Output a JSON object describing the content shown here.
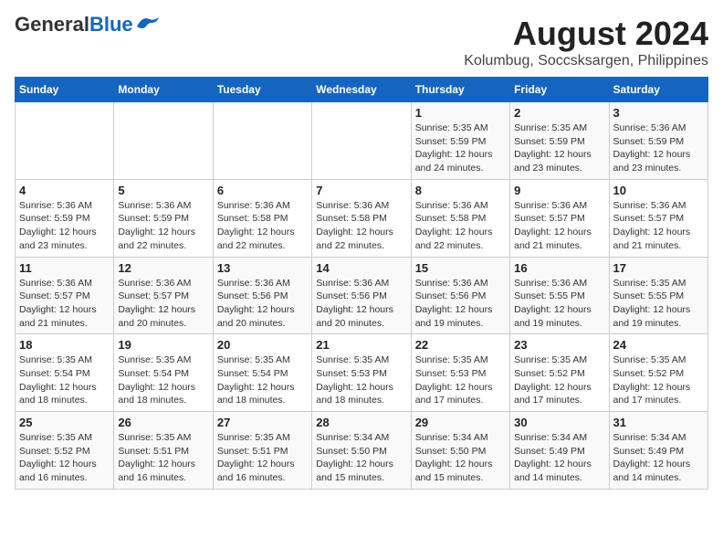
{
  "logo": {
    "general": "General",
    "blue": "Blue"
  },
  "title": "August 2024",
  "subtitle": "Kolumbug, Soccsksargen, Philippines",
  "days_of_week": [
    "Sunday",
    "Monday",
    "Tuesday",
    "Wednesday",
    "Thursday",
    "Friday",
    "Saturday"
  ],
  "weeks": [
    [
      {
        "day": "",
        "info": ""
      },
      {
        "day": "",
        "info": ""
      },
      {
        "day": "",
        "info": ""
      },
      {
        "day": "",
        "info": ""
      },
      {
        "day": "1",
        "info": "Sunrise: 5:35 AM\nSunset: 5:59 PM\nDaylight: 12 hours\nand 24 minutes."
      },
      {
        "day": "2",
        "info": "Sunrise: 5:35 AM\nSunset: 5:59 PM\nDaylight: 12 hours\nand 23 minutes."
      },
      {
        "day": "3",
        "info": "Sunrise: 5:36 AM\nSunset: 5:59 PM\nDaylight: 12 hours\nand 23 minutes."
      }
    ],
    [
      {
        "day": "4",
        "info": "Sunrise: 5:36 AM\nSunset: 5:59 PM\nDaylight: 12 hours\nand 23 minutes."
      },
      {
        "day": "5",
        "info": "Sunrise: 5:36 AM\nSunset: 5:59 PM\nDaylight: 12 hours\nand 22 minutes."
      },
      {
        "day": "6",
        "info": "Sunrise: 5:36 AM\nSunset: 5:58 PM\nDaylight: 12 hours\nand 22 minutes."
      },
      {
        "day": "7",
        "info": "Sunrise: 5:36 AM\nSunset: 5:58 PM\nDaylight: 12 hours\nand 22 minutes."
      },
      {
        "day": "8",
        "info": "Sunrise: 5:36 AM\nSunset: 5:58 PM\nDaylight: 12 hours\nand 22 minutes."
      },
      {
        "day": "9",
        "info": "Sunrise: 5:36 AM\nSunset: 5:57 PM\nDaylight: 12 hours\nand 21 minutes."
      },
      {
        "day": "10",
        "info": "Sunrise: 5:36 AM\nSunset: 5:57 PM\nDaylight: 12 hours\nand 21 minutes."
      }
    ],
    [
      {
        "day": "11",
        "info": "Sunrise: 5:36 AM\nSunset: 5:57 PM\nDaylight: 12 hours\nand 21 minutes."
      },
      {
        "day": "12",
        "info": "Sunrise: 5:36 AM\nSunset: 5:57 PM\nDaylight: 12 hours\nand 20 minutes."
      },
      {
        "day": "13",
        "info": "Sunrise: 5:36 AM\nSunset: 5:56 PM\nDaylight: 12 hours\nand 20 minutes."
      },
      {
        "day": "14",
        "info": "Sunrise: 5:36 AM\nSunset: 5:56 PM\nDaylight: 12 hours\nand 20 minutes."
      },
      {
        "day": "15",
        "info": "Sunrise: 5:36 AM\nSunset: 5:56 PM\nDaylight: 12 hours\nand 19 minutes."
      },
      {
        "day": "16",
        "info": "Sunrise: 5:36 AM\nSunset: 5:55 PM\nDaylight: 12 hours\nand 19 minutes."
      },
      {
        "day": "17",
        "info": "Sunrise: 5:35 AM\nSunset: 5:55 PM\nDaylight: 12 hours\nand 19 minutes."
      }
    ],
    [
      {
        "day": "18",
        "info": "Sunrise: 5:35 AM\nSunset: 5:54 PM\nDaylight: 12 hours\nand 18 minutes."
      },
      {
        "day": "19",
        "info": "Sunrise: 5:35 AM\nSunset: 5:54 PM\nDaylight: 12 hours\nand 18 minutes."
      },
      {
        "day": "20",
        "info": "Sunrise: 5:35 AM\nSunset: 5:54 PM\nDaylight: 12 hours\nand 18 minutes."
      },
      {
        "day": "21",
        "info": "Sunrise: 5:35 AM\nSunset: 5:53 PM\nDaylight: 12 hours\nand 18 minutes."
      },
      {
        "day": "22",
        "info": "Sunrise: 5:35 AM\nSunset: 5:53 PM\nDaylight: 12 hours\nand 17 minutes."
      },
      {
        "day": "23",
        "info": "Sunrise: 5:35 AM\nSunset: 5:52 PM\nDaylight: 12 hours\nand 17 minutes."
      },
      {
        "day": "24",
        "info": "Sunrise: 5:35 AM\nSunset: 5:52 PM\nDaylight: 12 hours\nand 17 minutes."
      }
    ],
    [
      {
        "day": "25",
        "info": "Sunrise: 5:35 AM\nSunset: 5:52 PM\nDaylight: 12 hours\nand 16 minutes."
      },
      {
        "day": "26",
        "info": "Sunrise: 5:35 AM\nSunset: 5:51 PM\nDaylight: 12 hours\nand 16 minutes."
      },
      {
        "day": "27",
        "info": "Sunrise: 5:35 AM\nSunset: 5:51 PM\nDaylight: 12 hours\nand 16 minutes."
      },
      {
        "day": "28",
        "info": "Sunrise: 5:34 AM\nSunset: 5:50 PM\nDaylight: 12 hours\nand 15 minutes."
      },
      {
        "day": "29",
        "info": "Sunrise: 5:34 AM\nSunset: 5:50 PM\nDaylight: 12 hours\nand 15 minutes."
      },
      {
        "day": "30",
        "info": "Sunrise: 5:34 AM\nSunset: 5:49 PM\nDaylight: 12 hours\nand 14 minutes."
      },
      {
        "day": "31",
        "info": "Sunrise: 5:34 AM\nSunset: 5:49 PM\nDaylight: 12 hours\nand 14 minutes."
      }
    ]
  ]
}
